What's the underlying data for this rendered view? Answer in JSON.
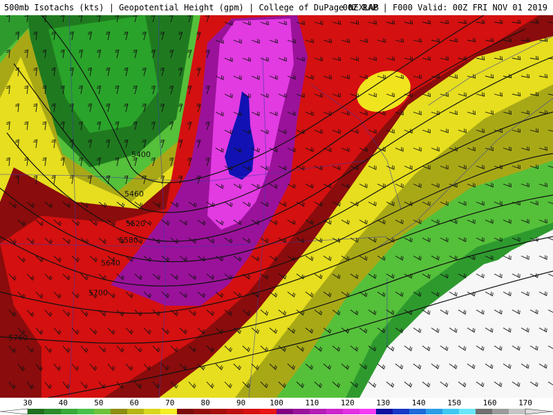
{
  "header": {
    "left_text": "500mb Isotachs (kts) | Geopotential Height (gpm) | College of DuPage NEXLAB",
    "right_text": "00Z RAP | F000 Valid: 00Z FRI NOV 01 2019"
  },
  "contours": {
    "labels": [
      "5400",
      "5460",
      "5520",
      "5580",
      "5640",
      "5700",
      "5760"
    ]
  },
  "colorbar": {
    "ticks": [
      "30",
      "40",
      "50",
      "60",
      "70",
      "80",
      "90",
      "100",
      "110",
      "120",
      "130",
      "140",
      "150",
      "160",
      "170"
    ],
    "colors": [
      "#1f6f1f",
      "#2a8a2a",
      "#38a838",
      "#48c048",
      "#6fc13a",
      "#8d8d12",
      "#b5b514",
      "#d9d61c",
      "#f4ee22",
      "#7d0a0a",
      "#930b0b",
      "#a60c0c",
      "#be0e0e",
      "#d51010",
      "#ea1414",
      "#800080",
      "#9a129a",
      "#b51cb5",
      "#cc25cc",
      "#e22fe2",
      "#f53cf5",
      "#1010a0",
      "#1638c4",
      "#1e6ad8",
      "#2b9ce6",
      "#3fc7f2",
      "#6ae6fa",
      "#707070",
      "#9a9a9a",
      "#c4c4c4"
    ]
  }
}
